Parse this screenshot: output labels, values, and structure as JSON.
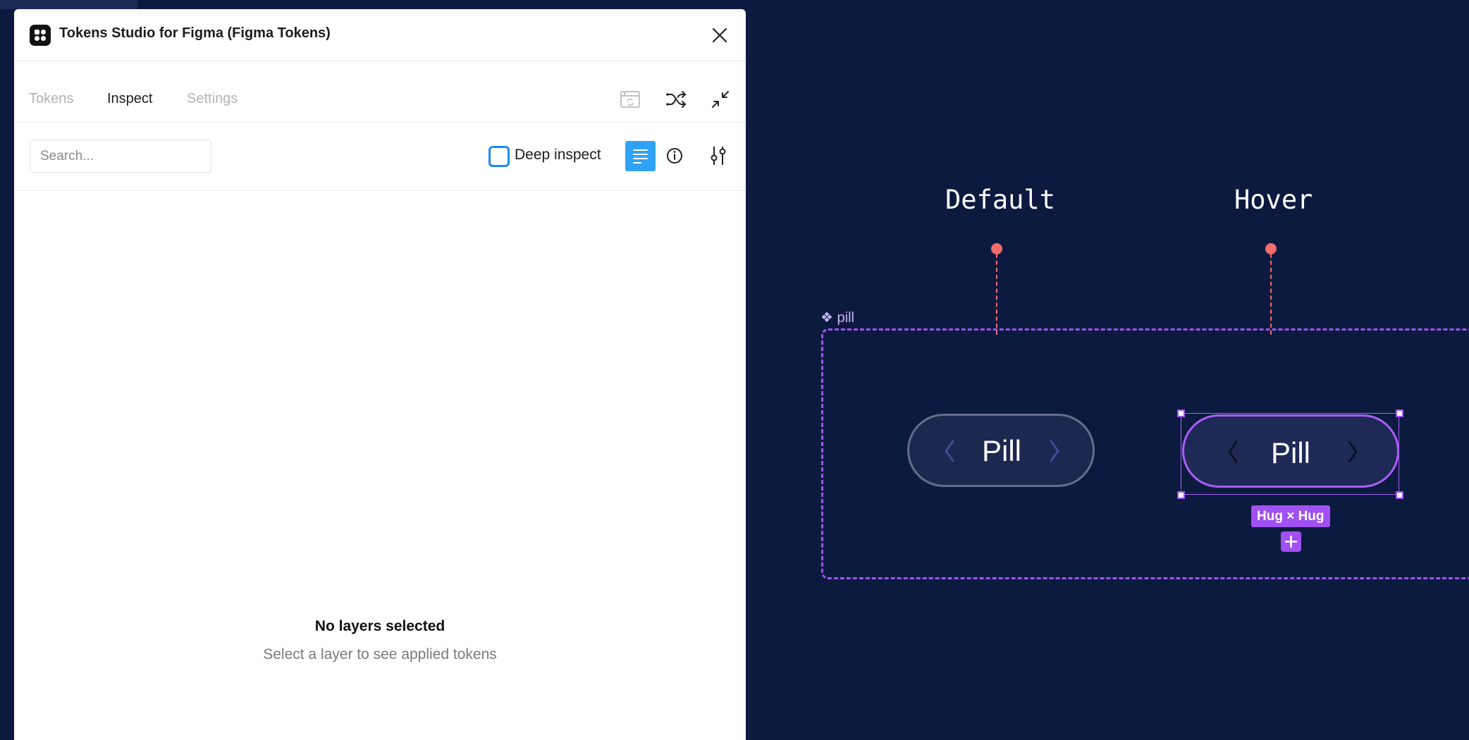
{
  "plugin": {
    "title": "Tokens Studio for Figma (Figma Tokens)",
    "tabs": [
      {
        "label": "Tokens",
        "active": false
      },
      {
        "label": "Inspect",
        "active": true
      },
      {
        "label": "Settings",
        "active": false
      }
    ],
    "toolbar_icons": [
      "window-sync-icon",
      "shuffle-icon",
      "collapse-icon"
    ],
    "inspect": {
      "search_placeholder": "Search...",
      "deep_inspect_label": "Deep inspect",
      "deep_inspect_checked": false,
      "view_icons": [
        "list-view-icon",
        "info-icon",
        "sliders-icon"
      ]
    },
    "empty_state": {
      "title": "No layers selected",
      "subtitle": "Select a layer to see applied tokens"
    }
  },
  "canvas": {
    "state_labels": [
      "Default",
      "Hover"
    ],
    "frame_name": "pill",
    "pills": [
      {
        "state": "Default",
        "label": "Pill"
      },
      {
        "state": "Hover",
        "label": "Pill",
        "selected": true
      }
    ],
    "selection_badge": "Hug × Hug"
  },
  "colors": {
    "canvas_bg": "#0d1a3f",
    "accent_blue": "#30a2f5",
    "selection_purple": "#a150f2",
    "pin_red": "#f36b6b"
  }
}
